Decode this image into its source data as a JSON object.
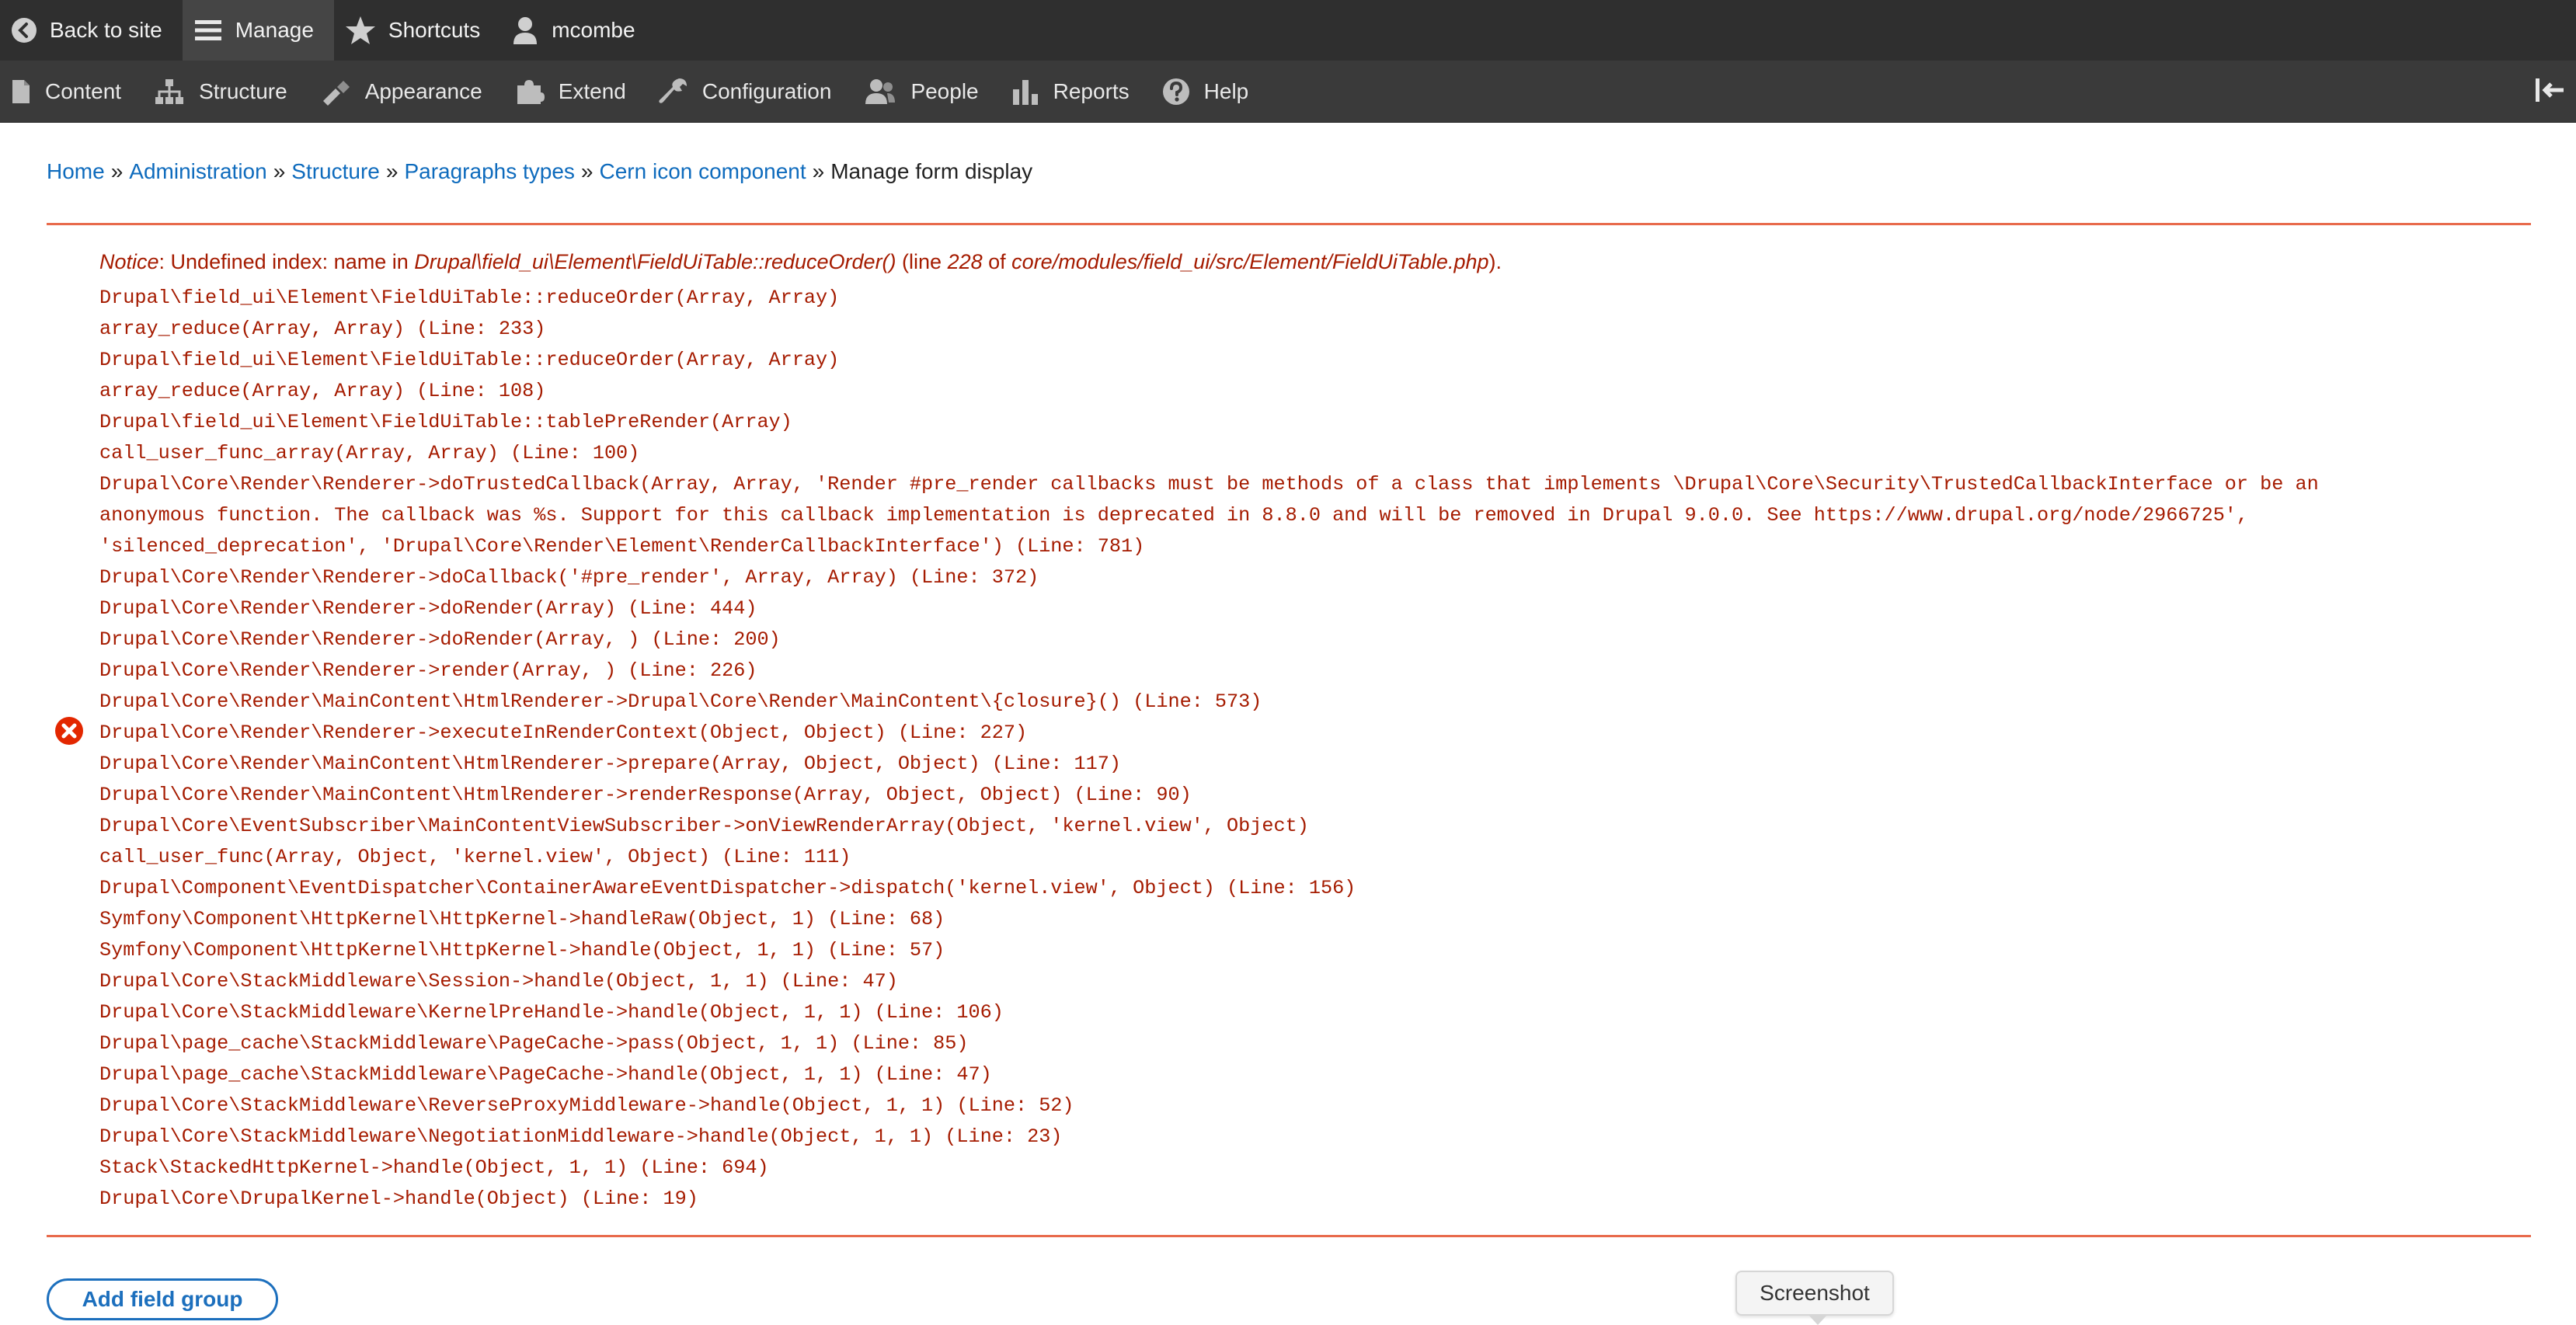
{
  "toolbar": {
    "back_label": "Back to site",
    "manage_label": "Manage",
    "shortcuts_label": "Shortcuts",
    "user_label": "mcombe"
  },
  "admin_menu": {
    "content": "Content",
    "structure": "Structure",
    "appearance": "Appearance",
    "extend": "Extend",
    "configuration": "Configuration",
    "people": "People",
    "reports": "Reports",
    "help": "Help"
  },
  "breadcrumb": {
    "separator": "»",
    "items": [
      "Home",
      "Administration",
      "Structure",
      "Paragraphs types",
      "Cern icon component"
    ],
    "current": "Manage form display"
  },
  "error": {
    "notice_label": "Notice",
    "notice_p1": ": Undefined index: name in ",
    "notice_function": "Drupal\\field_ui\\Element\\FieldUiTable::reduceOrder()",
    "notice_p2": " (line ",
    "notice_line": "228",
    "notice_p3": " of ",
    "notice_file": "core/modules/field_ui/src/Element/FieldUiTable.php",
    "notice_p4": ").",
    "trace": [
      "Drupal\\field_ui\\Element\\FieldUiTable::reduceOrder(Array, Array)",
      "array_reduce(Array, Array) (Line: 233)",
      "Drupal\\field_ui\\Element\\FieldUiTable::reduceOrder(Array, Array)",
      "array_reduce(Array, Array) (Line: 108)",
      "Drupal\\field_ui\\Element\\FieldUiTable::tablePreRender(Array)",
      "call_user_func_array(Array, Array) (Line: 100)",
      "Drupal\\Core\\Render\\Renderer->doTrustedCallback(Array, Array, 'Render #pre_render callbacks must be methods of a class that implements \\Drupal\\Core\\Security\\TrustedCallbackInterface or be an",
      "anonymous function. The callback was %s. Support for this callback implementation is deprecated in 8.8.0 and will be removed in Drupal 9.0.0. See https://www.drupal.org/node/2966725',",
      "'silenced_deprecation', 'Drupal\\Core\\Render\\Element\\RenderCallbackInterface') (Line: 781)",
      "Drupal\\Core\\Render\\Renderer->doCallback('#pre_render', Array, Array) (Line: 372)",
      "Drupal\\Core\\Render\\Renderer->doRender(Array) (Line: 444)",
      "Drupal\\Core\\Render\\Renderer->doRender(Array, ) (Line: 200)",
      "Drupal\\Core\\Render\\Renderer->render(Array, ) (Line: 226)",
      "Drupal\\Core\\Render\\MainContent\\HtmlRenderer->Drupal\\Core\\Render\\MainContent\\{closure}() (Line: 573)",
      "Drupal\\Core\\Render\\Renderer->executeInRenderContext(Object, Object) (Line: 227)",
      "Drupal\\Core\\Render\\MainContent\\HtmlRenderer->prepare(Array, Object, Object) (Line: 117)",
      "Drupal\\Core\\Render\\MainContent\\HtmlRenderer->renderResponse(Array, Object, Object) (Line: 90)",
      "Drupal\\Core\\EventSubscriber\\MainContentViewSubscriber->onViewRenderArray(Object, 'kernel.view', Object)",
      "call_user_func(Array, Object, 'kernel.view', Object) (Line: 111)",
      "Drupal\\Component\\EventDispatcher\\ContainerAwareEventDispatcher->dispatch('kernel.view', Object) (Line: 156)",
      "Symfony\\Component\\HttpKernel\\HttpKernel->handleRaw(Object, 1) (Line: 68)",
      "Symfony\\Component\\HttpKernel\\HttpKernel->handle(Object, 1, 1) (Line: 57)",
      "Drupal\\Core\\StackMiddleware\\Session->handle(Object, 1, 1) (Line: 47)",
      "Drupal\\Core\\StackMiddleware\\KernelPreHandle->handle(Object, 1, 1) (Line: 106)",
      "Drupal\\page_cache\\StackMiddleware\\PageCache->pass(Object, 1, 1) (Line: 85)",
      "Drupal\\page_cache\\StackMiddleware\\PageCache->handle(Object, 1, 1) (Line: 47)",
      "Drupal\\Core\\StackMiddleware\\ReverseProxyMiddleware->handle(Object, 1, 1) (Line: 52)",
      "Drupal\\Core\\StackMiddleware\\NegotiationMiddleware->handle(Object, 1, 1) (Line: 23)",
      "Stack\\StackedHttpKernel->handle(Object, 1, 1) (Line: 694)",
      "Drupal\\Core\\DrupalKernel->handle(Object) (Line: 19)"
    ]
  },
  "actions": {
    "add_field_group": "Add field group"
  },
  "tooltip": {
    "label": "Screenshot"
  },
  "colors": {
    "toolbar_bg": "#2f2f2f",
    "menu_bg": "#3a3a3a",
    "link": "#0e6bbd",
    "error_text": "#a51b00",
    "error_rule": "#e86a4b",
    "error_icon": "#e32700",
    "button_border": "#1c6fbd"
  },
  "icons": {
    "back": "back-arrow-circle-icon",
    "manage": "hamburger-menu-icon",
    "shortcuts": "star-icon",
    "user": "user-icon",
    "content": "document-icon",
    "structure": "sitemap-icon",
    "appearance": "paintbrush-icon",
    "extend": "puzzle-icon",
    "configuration": "wrench-icon",
    "people": "people-icon",
    "reports": "bar-chart-icon",
    "help": "question-circle-icon",
    "collapse": "collapse-toolbar-icon",
    "error": "error-x-circle-icon"
  }
}
